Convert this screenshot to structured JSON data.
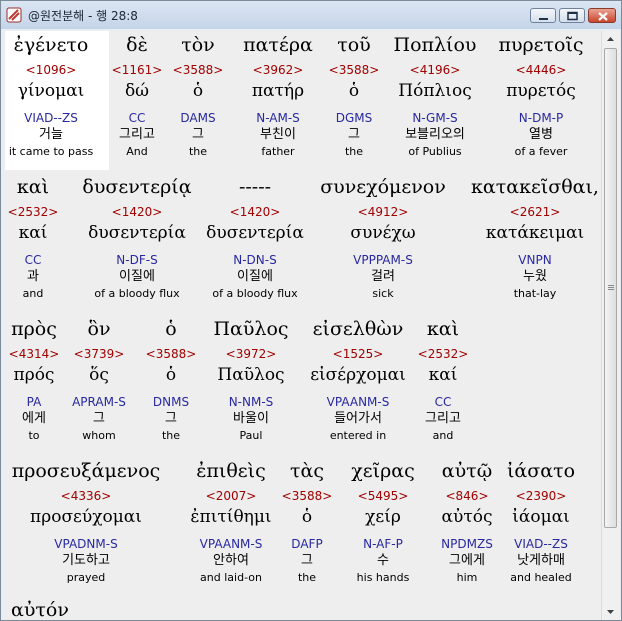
{
  "window": {
    "title": "@원전분해 - 행 28:8"
  },
  "rows": [
    {
      "words": [
        {
          "greek": "ἐγένετο",
          "strong": "<1096>",
          "lemma": "γίνομαι",
          "morph": "VIAD--ZS",
          "korean": "거늘",
          "english": "it came to pass"
        },
        {
          "greek": "δὲ",
          "strong": "<1161>",
          "lemma": "δώ",
          "morph": "CC",
          "korean": "그리고",
          "english": "And"
        },
        {
          "greek": "τὸν",
          "strong": "<3588>",
          "lemma": "ὁ",
          "morph": "DAMS",
          "korean": "그",
          "english": "the"
        },
        {
          "greek": "πατέρα",
          "strong": "<3962>",
          "lemma": "πατήρ",
          "morph": "N-AM-S",
          "korean": "부친이",
          "english": "father"
        },
        {
          "greek": "τοῦ",
          "strong": "<3588>",
          "lemma": "ὁ",
          "morph": "DGMS",
          "korean": "그",
          "english": "the"
        },
        {
          "greek": "Ποπλίου",
          "strong": "<4196>",
          "lemma": "Πόπλιος",
          "morph": "N-GM-S",
          "korean": "보블리오의",
          "english": "of Publius"
        },
        {
          "greek": "πυρετοῖς",
          "strong": "<4446>",
          "lemma": "πυρετός",
          "morph": "N-DM-P",
          "korean": "열병",
          "english": "of a fever"
        }
      ]
    },
    {
      "words": [
        {
          "greek": "καὶ",
          "strong": "<2532>",
          "lemma": "καί",
          "morph": "CC",
          "korean": "과",
          "english": "and"
        },
        {
          "greek": "δυσεντερίᾳ",
          "strong": "<1420>",
          "lemma": "δυσεντερία",
          "morph": "N-DF-S",
          "korean": "이질에",
          "english": "of a bloody flux"
        },
        {
          "greek": "-----",
          "strong": "<1420>",
          "lemma": "δυσεντερία",
          "morph": "N-DN-S",
          "korean": "이질에",
          "english": "of a bloody flux"
        },
        {
          "greek": "συνεχόμενον",
          "strong": "<4912>",
          "lemma": "συνέχω",
          "morph": "VPPPAM-S",
          "korean": "걸려",
          "english": "sick"
        },
        {
          "greek": "κατακεῖσθαι,",
          "strong": "<2621>",
          "lemma": "κατάκειμαι",
          "morph": "VNPN",
          "korean": "누웠",
          "english": "that-lay"
        }
      ]
    },
    {
      "words": [
        {
          "greek": "πρὸς",
          "strong": "<4314>",
          "lemma": "πρός",
          "morph": "PA",
          "korean": "에게",
          "english": "to"
        },
        {
          "greek": "ὃν",
          "strong": "<3739>",
          "lemma": "ὅς",
          "morph": "APRAM-S",
          "korean": "그",
          "english": "whom"
        },
        {
          "greek": "ὁ",
          "strong": "<3588>",
          "lemma": "ὁ",
          "morph": "DNMS",
          "korean": "그",
          "english": "the"
        },
        {
          "greek": "Παῦλος",
          "strong": "<3972>",
          "lemma": "Παῦλος",
          "morph": "N-NM-S",
          "korean": "바울이",
          "english": "Paul"
        },
        {
          "greek": "εἰσελθὼν",
          "strong": "<1525>",
          "lemma": "εἰσέρχομαι",
          "morph": "VPAANM-S",
          "korean": "들어가서",
          "english": "entered in"
        },
        {
          "greek": "καὶ",
          "strong": "<2532>",
          "lemma": "καί",
          "morph": "CC",
          "korean": "그리고",
          "english": "and"
        }
      ]
    },
    {
      "words": [
        {
          "greek": "προσευξάμενος",
          "strong": "<4336>",
          "lemma": "προσεύχομαι",
          "morph": "VPADNM-S",
          "korean": "기도하고",
          "english": "prayed"
        },
        {
          "greek": "ἐπιθεὶς",
          "strong": "<2007>",
          "lemma": "ἐπιτίθημι",
          "morph": "VPAANM-S",
          "korean": "안하여",
          "english": "and laid-on"
        },
        {
          "greek": "τὰς",
          "strong": "<3588>",
          "lemma": "ὁ",
          "morph": "DAFP",
          "korean": "그",
          "english": "the"
        },
        {
          "greek": "χεῖρας",
          "strong": "<5495>",
          "lemma": "χείρ",
          "morph": "N-AF-P",
          "korean": "수",
          "english": "his hands"
        },
        {
          "greek": "αὐτῷ",
          "strong": "<846>",
          "lemma": "αὐτός",
          "morph": "NPDMZS",
          "korean": "그에게",
          "english": "him"
        },
        {
          "greek": "ἰάσατο",
          "strong": "<2390>",
          "lemma": "ἰάομαι",
          "morph": "VIAD--ZS",
          "korean": "낫게하매",
          "english": "and healed"
        }
      ]
    }
  ],
  "partial_next_word": "αὐτόν"
}
